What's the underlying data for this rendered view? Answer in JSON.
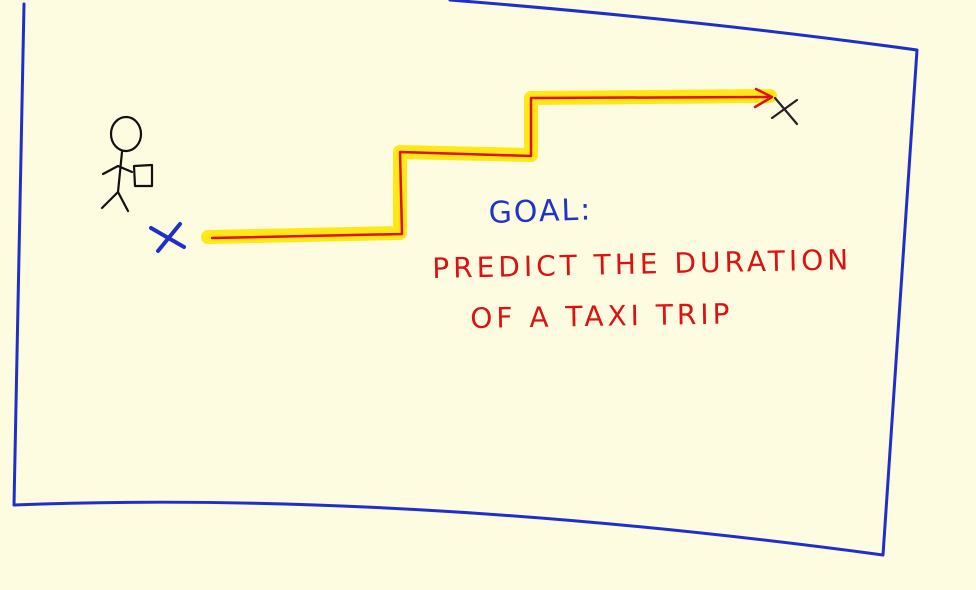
{
  "goal": {
    "title": "GOAL:",
    "line1": "PREDICT THE DURATION",
    "line2": "OF A TAXI TRIP"
  },
  "colors": {
    "background": "#fdfbe0",
    "frame": "#1f2fcc",
    "highlight": "#ffe600",
    "path": "#dd1111",
    "start_marker": "#1f2fcc",
    "end_marker": "#222222",
    "figure": "#111111",
    "goal_title": "#2233cc",
    "goal_text": "#dd1111"
  },
  "icons": [
    "stick-figure-icon",
    "start-x-marker-icon",
    "end-x-marker-icon",
    "arrow-head-icon"
  ]
}
